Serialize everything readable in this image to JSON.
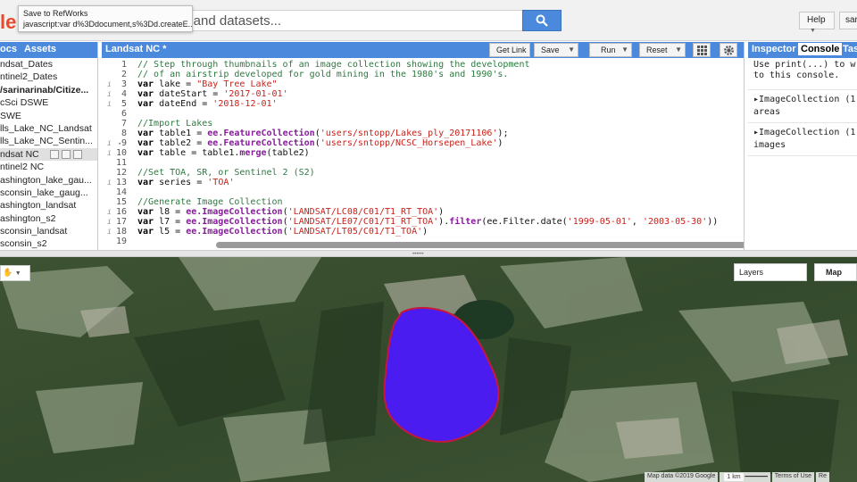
{
  "header": {
    "logo_text": "le",
    "search_placeholder": "s and datasets...",
    "tooltip_title": "Save to RefWorks",
    "tooltip_url": "javascript:var d%3Ddocument,s%3Dd.createE...",
    "help_label": "Help",
    "user_label": "sari"
  },
  "left_panel": {
    "tabs": [
      "ocs",
      "Assets"
    ],
    "items": [
      {
        "label": "ndsat_Dates",
        "bold": false,
        "selected": false
      },
      {
        "label": "ntinel2_Dates",
        "bold": false,
        "selected": false
      },
      {
        "label": "/sarinarinab/Citize...",
        "bold": true,
        "selected": false
      },
      {
        "label": "cSci DSWE",
        "bold": false,
        "selected": false
      },
      {
        "label": "SWE",
        "bold": false,
        "selected": false
      },
      {
        "label": "lls_Lake_NC_Landsat",
        "bold": false,
        "selected": false
      },
      {
        "label": "lls_Lake_NC_Sentin...",
        "bold": false,
        "selected": false
      },
      {
        "label": "ndsat NC",
        "bold": false,
        "selected": true
      },
      {
        "label": "ntinel2 NC",
        "bold": false,
        "selected": false
      },
      {
        "label": "ashington_lake_gau...",
        "bold": false,
        "selected": false
      },
      {
        "label": "sconsin_lake_gaug...",
        "bold": false,
        "selected": false
      },
      {
        "label": "ashington_landsat",
        "bold": false,
        "selected": false
      },
      {
        "label": "ashington_s2",
        "bold": false,
        "selected": false
      },
      {
        "label": "sconsin_landsat",
        "bold": false,
        "selected": false
      },
      {
        "label": "sconsin_s2",
        "bold": false,
        "selected": false
      }
    ]
  },
  "editor": {
    "title": "Landsat NC *",
    "buttons": {
      "get_link": "Get Link",
      "save": "Save",
      "run": "Run",
      "reset": "Reset"
    },
    "lines": [
      {
        "n": "1",
        "info": false,
        "parts": [
          [
            "cm",
            "// Step through thumbnails of an image collection showing the development"
          ]
        ]
      },
      {
        "n": "2",
        "info": false,
        "parts": [
          [
            "cm",
            "// of an airstrip developed for gold mining in the 1980's and 1990's."
          ]
        ]
      },
      {
        "n": "3",
        "info": true,
        "parts": [
          [
            "kw",
            "var"
          ],
          [
            "plain",
            " lake = "
          ],
          [
            "str",
            "\"Bay Tree Lake\""
          ]
        ]
      },
      {
        "n": "4",
        "info": true,
        "parts": [
          [
            "kw",
            "var"
          ],
          [
            "plain",
            " dateStart =  "
          ],
          [
            "str",
            "'2017-01-01'"
          ]
        ]
      },
      {
        "n": "5",
        "info": true,
        "parts": [
          [
            "kw",
            "var"
          ],
          [
            "plain",
            " dateEnd = "
          ],
          [
            "str",
            "'2018-12-01'"
          ]
        ]
      },
      {
        "n": "6",
        "info": false,
        "parts": []
      },
      {
        "n": "7",
        "info": false,
        "parts": [
          [
            "cm",
            "//Import Lakes"
          ]
        ]
      },
      {
        "n": "8",
        "info": false,
        "parts": [
          [
            "kw",
            "var"
          ],
          [
            "plain",
            " table1 = "
          ],
          [
            "fn",
            "ee.FeatureCollection"
          ],
          [
            "plain",
            "("
          ],
          [
            "str",
            "'users/sntopp/Lakes_ply_20171106'"
          ],
          [
            "plain",
            ");"
          ]
        ]
      },
      {
        "n": "9",
        "info": true,
        "parts": [
          [
            "kw",
            "var"
          ],
          [
            "plain",
            " table2 = "
          ],
          [
            "fn",
            "ee.FeatureCollection"
          ],
          [
            "plain",
            "("
          ],
          [
            "str",
            "'users/sntopp/NCSC_Horsepen_Lake'"
          ],
          [
            "plain",
            ")"
          ]
        ]
      },
      {
        "n": "10",
        "info": true,
        "parts": [
          [
            "kw",
            "var"
          ],
          [
            "plain",
            " table = table1."
          ],
          [
            "fn",
            "merge"
          ],
          [
            "plain",
            "(table2)"
          ]
        ]
      },
      {
        "n": "11",
        "info": false,
        "parts": []
      },
      {
        "n": "12",
        "info": false,
        "parts": [
          [
            "cm",
            "//Set TOA, SR, or Sentinel 2 (S2)"
          ]
        ]
      },
      {
        "n": "13",
        "info": true,
        "parts": [
          [
            "kw",
            "var"
          ],
          [
            "plain",
            " series = "
          ],
          [
            "str",
            "'TOA'"
          ]
        ]
      },
      {
        "n": "14",
        "info": false,
        "parts": []
      },
      {
        "n": "15",
        "info": false,
        "parts": [
          [
            "cm",
            "//Generate Image Collection"
          ]
        ]
      },
      {
        "n": "16",
        "info": true,
        "parts": [
          [
            "kw",
            "var"
          ],
          [
            "plain",
            " l8 = "
          ],
          [
            "fn",
            "ee.ImageCollection"
          ],
          [
            "plain",
            "("
          ],
          [
            "str",
            "'LANDSAT/LC08/C01/T1_RT_TOA'"
          ],
          [
            "plain",
            ")"
          ]
        ]
      },
      {
        "n": "17",
        "info": true,
        "parts": [
          [
            "kw",
            "var"
          ],
          [
            "plain",
            " l7 = "
          ],
          [
            "fn",
            "ee.ImageCollection"
          ],
          [
            "plain",
            "("
          ],
          [
            "str",
            "'LANDSAT/LE07/C01/T1_RT_TOA'"
          ],
          [
            "plain",
            ")."
          ],
          [
            "fn",
            "filter"
          ],
          [
            "plain",
            "(ee.Filter.date("
          ],
          [
            "str",
            "'1999-05-01'"
          ],
          [
            "plain",
            ", "
          ],
          [
            "str",
            "'2003-05-30'"
          ],
          [
            "plain",
            "))"
          ]
        ]
      },
      {
        "n": "18",
        "info": true,
        "parts": [
          [
            "kw",
            "var"
          ],
          [
            "plain",
            " l5 = "
          ],
          [
            "fn",
            "ee.ImageCollection"
          ],
          [
            "plain",
            "("
          ],
          [
            "str",
            "'LANDSAT/LT05/C01/T1_TOA'"
          ],
          [
            "plain",
            ")"
          ]
        ]
      },
      {
        "n": "19",
        "info": false,
        "parts": []
      }
    ]
  },
  "right_panel": {
    "tabs": [
      "Inspector",
      "Console",
      "Tas"
    ],
    "intro_line1": "Use print(...) to w",
    "intro_line2": "to this console.",
    "items": [
      {
        "line1": "ImageCollection (1",
        "line2": "areas"
      },
      {
        "line1": "ImageCollection (1",
        "line2": "images"
      }
    ]
  },
  "map": {
    "layers_label": "Layers",
    "map_type_label": "Map",
    "attribution": "Map data ©2019 Google",
    "scale_label": "1 km",
    "terms_label": "Terms of Use",
    "report_label": "Re",
    "lake_fill": "#4a1cf0",
    "lake_outline": "#c8163c"
  }
}
